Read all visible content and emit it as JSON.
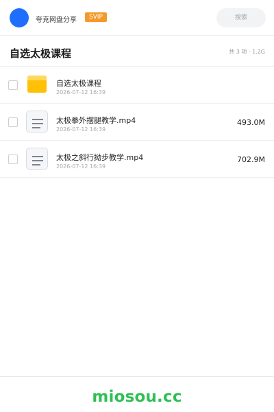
{
  "header": {
    "title": "夸克网盘分享",
    "badge": "SVIP",
    "search_placeholder": "搜索",
    "avatar_color": "#1f6fff",
    "badge_color": "#f39a2b"
  },
  "folder": {
    "title": "自选太极课程",
    "summary": "共 3 项 · 1.2G"
  },
  "files": [
    {
      "icon": "folder-icon",
      "name": "自选太极课程",
      "date": "2026-07-12 16:39",
      "size": ""
    },
    {
      "icon": "video-file-icon",
      "name": "太极拳外摆腿教学.mp4",
      "date": "2026-07-12 16:39",
      "size": "493.0M"
    },
    {
      "icon": "video-file-icon",
      "name": "太极之斜行拗步教学.mp4",
      "date": "2026-07-12 16:39",
      "size": "702.9M"
    }
  ],
  "footer": {
    "site": "miosou.cc",
    "site_color": "#2fbf55"
  }
}
